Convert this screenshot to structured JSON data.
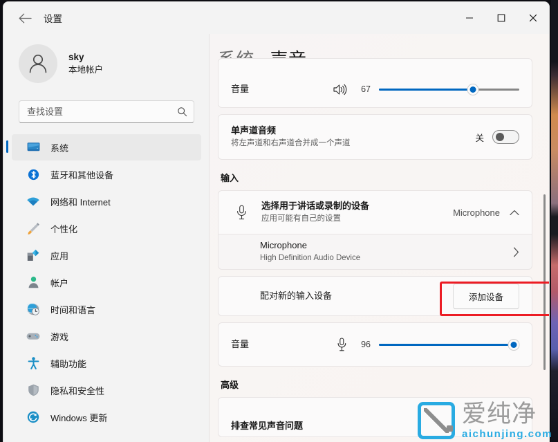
{
  "window": {
    "app_title": "设置",
    "back_icon": "back-arrow-icon",
    "minimize_label": "最小化",
    "maximize_label": "最大化",
    "close_label": "关闭"
  },
  "account": {
    "name": "sky",
    "type": "本地帐户",
    "avatar_icon": "person-avatar-icon"
  },
  "search": {
    "placeholder": "查找设置",
    "value": "",
    "icon": "search-icon"
  },
  "sidebar": {
    "items": [
      {
        "label": "系统",
        "icon": "monitor-icon",
        "selected": true
      },
      {
        "label": "蓝牙和其他设备",
        "icon": "bluetooth-icon",
        "selected": false
      },
      {
        "label": "网络和 Internet",
        "icon": "wifi-icon",
        "selected": false
      },
      {
        "label": "个性化",
        "icon": "paintbrush-icon",
        "selected": false
      },
      {
        "label": "应用",
        "icon": "apps-icon",
        "selected": false
      },
      {
        "label": "帐户",
        "icon": "account-icon",
        "selected": false
      },
      {
        "label": "时间和语言",
        "icon": "clock-globe-icon",
        "selected": false
      },
      {
        "label": "游戏",
        "icon": "gamepad-icon",
        "selected": false
      },
      {
        "label": "辅助功能",
        "icon": "accessibility-icon",
        "selected": false
      },
      {
        "label": "隐私和安全性",
        "icon": "shield-icon",
        "selected": false
      },
      {
        "label": "Windows 更新",
        "icon": "update-icon",
        "selected": false
      }
    ]
  },
  "breadcrumb": {
    "parent": "系统",
    "separator": "›",
    "current": "声音"
  },
  "output_volume": {
    "label": "音量",
    "icon": "speaker-icon",
    "value": "67",
    "percent": 67
  },
  "mono_audio": {
    "title": "单声道音频",
    "subtitle": "将左声道和右声道合并成一个声道",
    "state_label": "关",
    "state_on": false
  },
  "input_section": {
    "heading": "输入",
    "choose_device": {
      "title": "选择用于讲话或录制的设备",
      "subtitle": "应用可能有自己的设置",
      "icon": "microphone-icon",
      "selected_value": "Microphone",
      "expand_icon": "chevron-up-icon"
    },
    "device_entry": {
      "title": "Microphone",
      "subtitle": "High Definition Audio Device",
      "chevron_icon": "chevron-right-icon",
      "highlighted": true
    },
    "pair_device": {
      "label": "配对新的输入设备",
      "button_label": "添加设备"
    },
    "input_volume": {
      "label": "音量",
      "icon": "microphone-icon",
      "value": "96",
      "percent": 96
    }
  },
  "advanced_section": {
    "heading": "高级",
    "first_item": "排查常见声音问题"
  },
  "watermark": {
    "cn": "爱纯净",
    "en": "aichunjing.com"
  },
  "colors": {
    "accent": "#0067c0",
    "highlight": "#ec1c24",
    "watermark_blue": "#29abe2",
    "sidebar_bg": "#f3f3f3"
  }
}
